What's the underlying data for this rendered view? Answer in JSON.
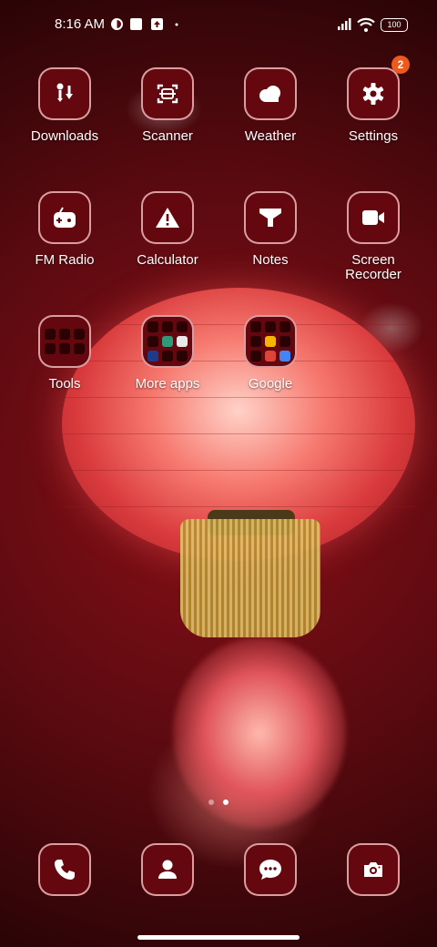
{
  "status_bar": {
    "time": "8:16 AM",
    "battery": "100"
  },
  "apps": [
    {
      "label": "Downloads",
      "icon": "downloads-icon"
    },
    {
      "label": "Scanner",
      "icon": "scanner-icon"
    },
    {
      "label": "Weather",
      "icon": "weather-icon"
    },
    {
      "label": "Settings",
      "icon": "gear-icon",
      "badge": "2"
    },
    {
      "label": "FM Radio",
      "icon": "radio-icon"
    },
    {
      "label": "Calculator",
      "icon": "calculator-icon"
    },
    {
      "label": "Notes",
      "icon": "notes-icon"
    },
    {
      "label": "Screen Recorder",
      "icon": "screen-recorder-icon"
    }
  ],
  "folders": [
    {
      "label": "Tools"
    },
    {
      "label": "More apps"
    },
    {
      "label": "Google"
    }
  ],
  "dock": [
    {
      "name": "phone",
      "icon": "phone-icon"
    },
    {
      "name": "contacts",
      "icon": "contacts-icon"
    },
    {
      "name": "messages",
      "icon": "messages-icon"
    },
    {
      "name": "camera",
      "icon": "camera-icon"
    }
  ],
  "page_indicator": {
    "pages": 2,
    "current": 2
  },
  "colors": {
    "tile_bg": "#65070f",
    "badge": "#ee5a1c"
  }
}
